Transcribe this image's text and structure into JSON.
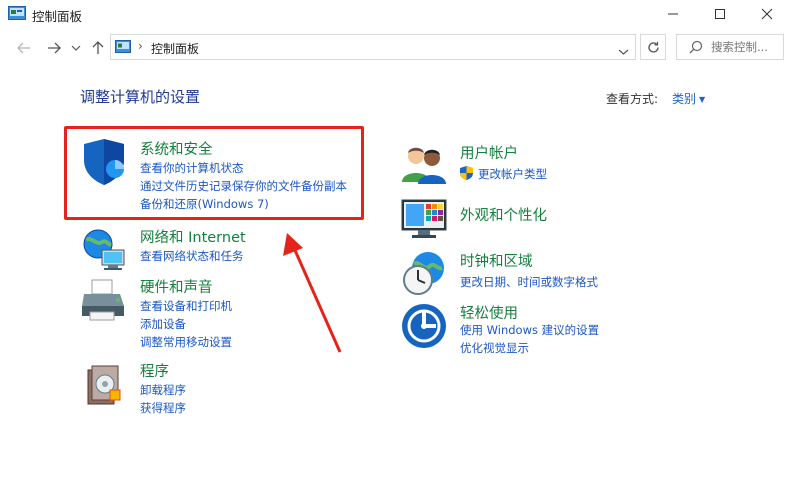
{
  "window": {
    "title": "控制面板",
    "controls": {
      "minimize": "—",
      "maximize": "☐",
      "close": "✕"
    }
  },
  "addressbar": {
    "breadcrumb": "控制面板",
    "search_placeholder": "搜索控制..."
  },
  "main": {
    "heading": "调整计算机的设置",
    "view_by_label": "查看方式:",
    "view_by_value": "类别"
  },
  "categories": {
    "system_security": {
      "title": "系统和安全",
      "links": [
        "查看你的计算机状态",
        "通过文件历史记录保存你的文件备份副本",
        "备份和还原(Windows 7)"
      ]
    },
    "network": {
      "title": "网络和 Internet",
      "links": [
        "查看网络状态和任务"
      ]
    },
    "hardware": {
      "title": "硬件和声音",
      "links": [
        "查看设备和打印机",
        "添加设备",
        "调整常用移动设置"
      ]
    },
    "programs": {
      "title": "程序",
      "links": [
        "卸载程序",
        "获得程序"
      ]
    },
    "user_accounts": {
      "title": "用户帐户",
      "links": [
        "更改帐户类型"
      ]
    },
    "appearance": {
      "title": "外观和个性化",
      "links": []
    },
    "clock_region": {
      "title": "时钟和区域",
      "links": [
        "更改日期、时间或数字格式"
      ]
    },
    "ease_of_access": {
      "title": "轻松使用",
      "links": [
        "使用 Windows 建议的设置",
        "优化视觉显示"
      ]
    }
  },
  "colors": {
    "category_title": "#15803d",
    "link": "#1a58c4",
    "heading": "#1f3a93",
    "annotation": "#e5231b"
  },
  "icons": {
    "app": "control-panel-icon",
    "back": "arrow-left-icon",
    "forward": "arrow-right-icon",
    "recent": "chevron-down-icon",
    "up": "arrow-up-icon",
    "refresh": "refresh-icon",
    "search": "search-icon"
  }
}
